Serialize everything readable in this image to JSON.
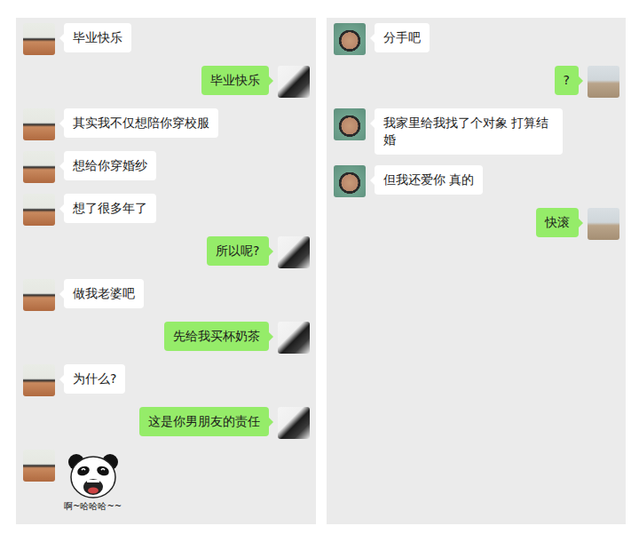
{
  "panels": [
    {
      "messages": [
        {
          "kind": "text",
          "from_me": false,
          "text": "毕业快乐"
        },
        {
          "kind": "text",
          "from_me": true,
          "text": "毕业快乐"
        },
        {
          "kind": "text",
          "from_me": false,
          "text": "其实我不仅想陪你穿校服"
        },
        {
          "kind": "text",
          "from_me": false,
          "text": "想给你穿婚纱"
        },
        {
          "kind": "text",
          "from_me": false,
          "text": "想了很多年了"
        },
        {
          "kind": "text",
          "from_me": true,
          "text": "所以呢?"
        },
        {
          "kind": "text",
          "from_me": false,
          "text": "做我老婆吧"
        },
        {
          "kind": "text",
          "from_me": true,
          "text": "先给我买杯奶茶"
        },
        {
          "kind": "text",
          "from_me": false,
          "text": "为什么?"
        },
        {
          "kind": "text",
          "from_me": true,
          "text": "这是你男朋友的责任"
        },
        {
          "kind": "sticker",
          "from_me": false,
          "text": "啊~哈哈哈~~"
        }
      ]
    },
    {
      "messages": [
        {
          "kind": "text",
          "from_me": false,
          "text": "分手吧"
        },
        {
          "kind": "text",
          "from_me": true,
          "text": "?"
        },
        {
          "kind": "text",
          "from_me": false,
          "text": "我家里给我找了个对象 打算结婚"
        },
        {
          "kind": "text",
          "from_me": false,
          "text": "但我还爱你 真的"
        },
        {
          "kind": "text",
          "from_me": true,
          "text": "快滚"
        }
      ]
    }
  ]
}
